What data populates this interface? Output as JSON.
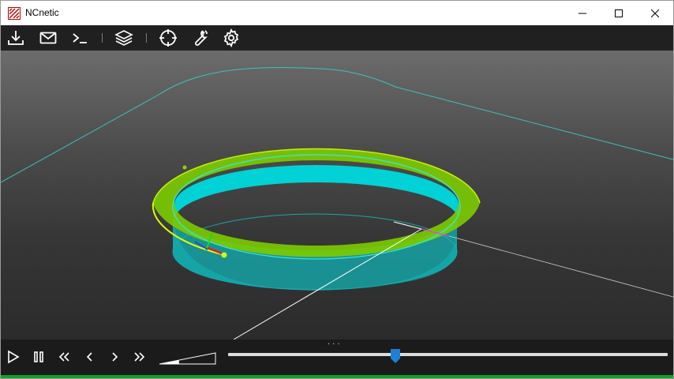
{
  "window": {
    "title": "NCnetic"
  },
  "titlebar": {
    "buttons": [
      "minimize",
      "maximize",
      "close"
    ]
  },
  "toolbar": {
    "icons": [
      "download-icon",
      "mail-icon",
      "terminal-icon",
      "layers-icon",
      "crosshair-icon",
      "wrench-icon",
      "gear-icon"
    ]
  },
  "player": {
    "dots": "...",
    "controls": [
      "play-icon",
      "pause-icon",
      "rewind-icon",
      "step-back-icon",
      "step-forward-icon",
      "fast-forward-icon"
    ],
    "timeline_position": 0.38,
    "speed_level": 0.35
  },
  "colors": {
    "toolbar_bg": "#202020",
    "player_bg": "#1b1b1b",
    "status_bar": "#16a02a",
    "part_top": "#7cd000",
    "part_wall": "#00c8c8",
    "outline": "#40c8c8",
    "slider_thumb": "#1f7fd6"
  }
}
